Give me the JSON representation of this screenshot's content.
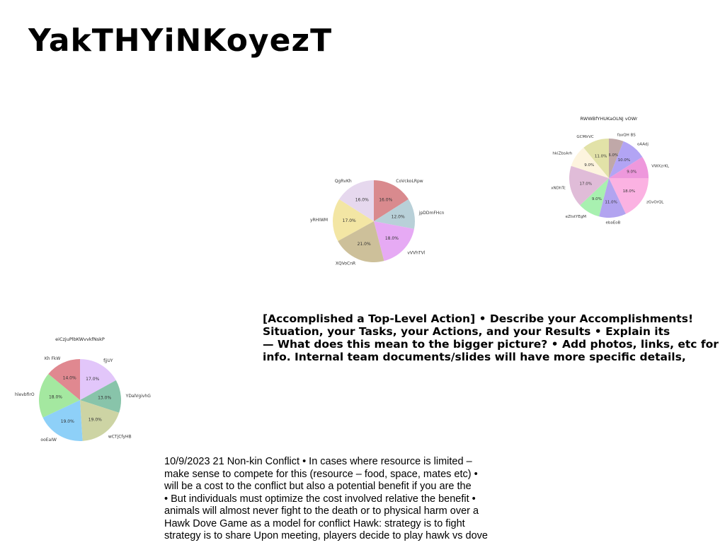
{
  "title": "YakTHYiNKoyezT",
  "charts": [
    {
      "type": "pie",
      "title": "",
      "labels": [
        "CoVckoLRpw",
        "jpDDmFHcn",
        "vVVhTVl",
        "XQVoCnR",
        "yRHIWM",
        "QgRvKh"
      ],
      "values": [
        16.0,
        12.0,
        18.0,
        21.0,
        17.0,
        16.0
      ],
      "value_labels": [
        "16.0%",
        "12.0%",
        "18.0%",
        "21.0%",
        "17.0%",
        "16.0%"
      ],
      "colors": [
        "#d98a8e",
        "#b8d0d8",
        "#e6aaf4",
        "#cdc09a",
        "#f3e6a4",
        "#e6d8ee"
      ]
    },
    {
      "type": "pie",
      "title": "RWWBfYHUKaOLNJ vOWr",
      "labels": [
        "faxQH BS",
        "oAAdj",
        "VWXzrKL",
        "zGvOrQL",
        "ebaEoB",
        "eZtstYEgM",
        "xNDhTc",
        "hkiZbsArh",
        "GCMIrVC"
      ],
      "values": [
        6.0,
        10.0,
        9.0,
        18.0,
        11.0,
        9.0,
        17.0,
        9.0,
        11.0
      ],
      "value_labels": [
        "6.0%",
        "10.0%",
        "9.0%",
        "18.0%",
        "11.0%",
        "9.0%",
        "17.0%",
        "9.0%",
        "11.0%"
      ],
      "colors": [
        "#c0a8a8",
        "#b2a4f4",
        "#ee98dc",
        "#fbb2e2",
        "#b2a4f0",
        "#a8f0b0",
        "#e0bcd8",
        "#fdf4de",
        "#e2e2a8"
      ]
    },
    {
      "type": "pie",
      "title": "eiCzjuPlbKWvvkfNskP",
      "labels": [
        "fjjUY",
        "YDalVgivhG",
        "wCTjCfyHB",
        "ooEaIW",
        "hlevbfirO",
        "Kh FkW"
      ],
      "values": [
        17.0,
        13.0,
        19.0,
        19.0,
        18.0,
        14.0
      ],
      "value_labels": [
        "17.0%",
        "13.0%",
        "19.0%",
        "19.0%",
        "18.0%",
        "14.0%"
      ],
      "colors": [
        "#e2c6fa",
        "#88c4aa",
        "#cdd4a4",
        "#8ed0f8",
        "#a4e8a0",
        "#e08890"
      ]
    }
  ],
  "bold_text": [
    "[Accomplished a Top-Level Action] • Describe your Accomplishments!",
    "Situation, your Tasks, your Actions, and your Results • Explain its",
    "— What does this mean to the bigger picture? • Add photos, links, etc for",
    "info. Internal team documents/slides will have more specific details,"
  ],
  "note_text": [
    "10/9/2023 21 Non-kin Conflict • In cases where resource is limited –",
    "make sense to compete for this (resource – food, space, mates etc) •",
    "will be a cost to the conflict but also a potential benefit if you are the",
    "• But individuals must optimize the cost involved relative the benefit •",
    "animals will almost never fight to the death or to physical harm over a",
    "Hawk Dove Game as a model for conflict Hawk: strategy is to fight",
    "strategy is to share Upon meeting, players decide to play hawk vs dove"
  ]
}
